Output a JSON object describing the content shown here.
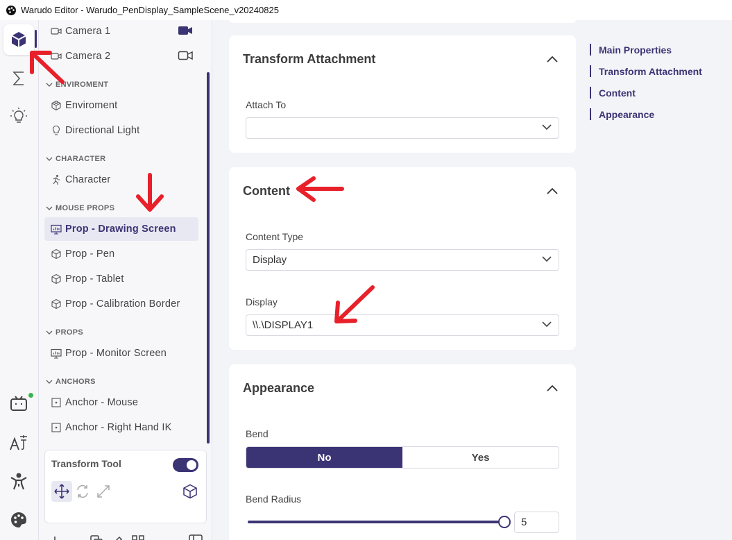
{
  "window": {
    "title": "Warudo Editor - Warudo_PenDisplay_SampleScene_v20240825"
  },
  "rail": {
    "items": [
      {
        "icon": "cube-icon",
        "active": true
      },
      {
        "icon": "sigma-icon"
      },
      {
        "icon": "lightbulb-icon"
      },
      {
        "icon": "bilibili-tv-icon"
      },
      {
        "icon": "translate-icon"
      },
      {
        "icon": "character-pose-icon"
      },
      {
        "icon": "palette-icon"
      }
    ]
  },
  "tree": {
    "items": [
      {
        "label": "Camera 1",
        "icon": "camera-icon"
      },
      {
        "label": "Camera 2",
        "icon": "camera-icon"
      }
    ],
    "sections": [
      {
        "label": "ENVIROMENT",
        "items": [
          "Enviroment",
          "Directional Light"
        ]
      },
      {
        "label": "CHARACTER",
        "items": [
          "Character"
        ]
      },
      {
        "label": "MOUSE PROPS",
        "items": [
          "Prop - Drawing Screen",
          "Prop - Pen",
          "Prop - Tablet",
          "Prop - Calibration Border"
        ]
      },
      {
        "label": "PROPS",
        "items": [
          "Prop - Monitor Screen"
        ]
      },
      {
        "label": "ANCHORS",
        "items": [
          "Anchor - Mouse",
          "Anchor - Right Hand IK"
        ]
      }
    ],
    "selected": "Prop - Drawing Screen",
    "transform_tool": {
      "label": "Transform Tool",
      "enabled": true
    }
  },
  "main": {
    "transform_attachment": {
      "title": "Transform Attachment",
      "attach_to_label": "Attach To",
      "attach_to_value": ""
    },
    "content": {
      "title": "Content",
      "content_type_label": "Content Type",
      "content_type_value": "Display",
      "display_label": "Display",
      "display_value": "\\\\.\\DISPLAY1"
    },
    "appearance": {
      "title": "Appearance",
      "bend_label": "Bend",
      "bend_no": "No",
      "bend_yes": "Yes",
      "bend_selected": "No",
      "bend_radius_label": "Bend Radius",
      "bend_radius_value": "5",
      "bend_radius_slider_fraction": 1.0
    }
  },
  "toc": {
    "items": [
      "Main Properties",
      "Transform Attachment",
      "Content",
      "Appearance"
    ]
  },
  "colors": {
    "accent": "#3b3474",
    "annotation": "#e8202a",
    "status_online": "#3cb44b"
  }
}
